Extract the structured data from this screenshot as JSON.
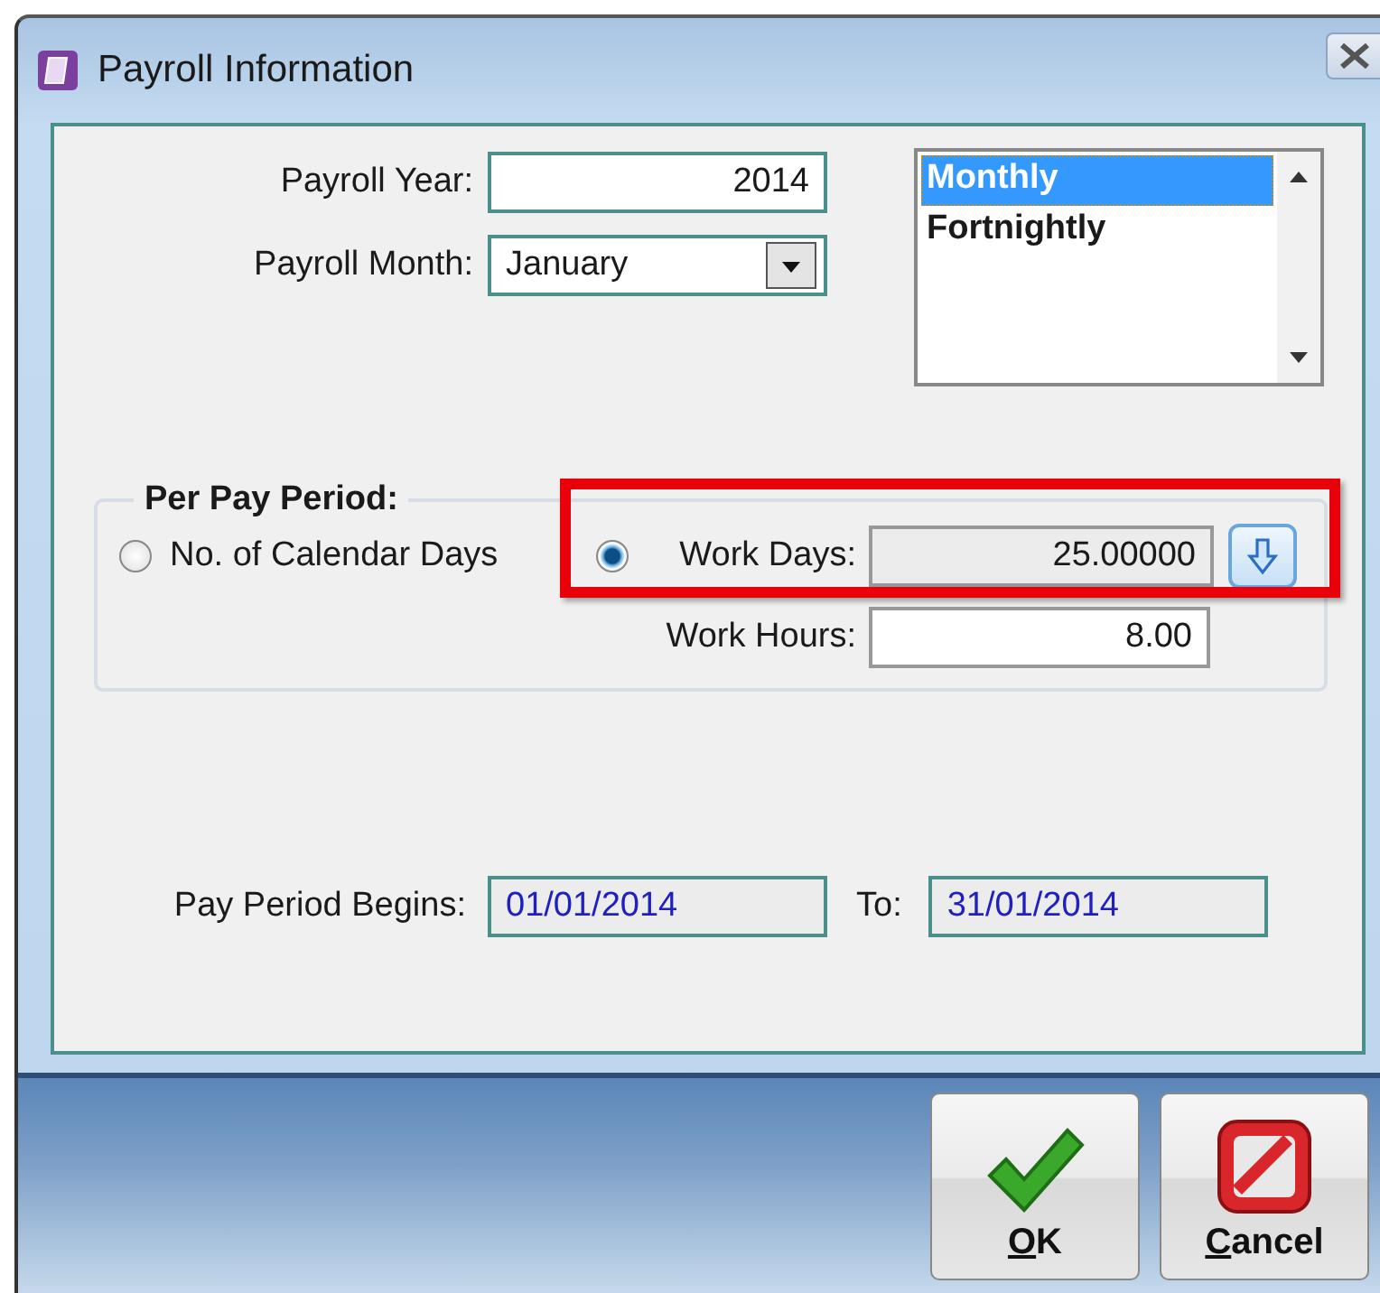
{
  "window": {
    "title": "Payroll Information"
  },
  "fields": {
    "payroll_year": {
      "label": "Payroll Year:",
      "value": "2014"
    },
    "payroll_month": {
      "label": "Payroll Month:",
      "value": "January"
    }
  },
  "frequency_list": {
    "items": [
      {
        "label": "Monthly",
        "selected": true
      },
      {
        "label": "Fortnightly",
        "selected": false
      }
    ]
  },
  "per_pay_period": {
    "title": "Per Pay Period:",
    "options": [
      {
        "label": "No. of Calendar Days",
        "selected": false,
        "highlighted": false
      },
      {
        "label": "Work Days:",
        "selected": true,
        "highlighted": true,
        "value": "25.00000"
      }
    ],
    "work_hours": {
      "label": "Work Hours:",
      "value": "8.00"
    }
  },
  "pay_period": {
    "begins_label": "Pay Period Begins:",
    "begins": "01/01/2014",
    "to_label": "To:",
    "to": "31/01/2014"
  },
  "buttons": [
    {
      "label": "OK",
      "kind": "ok"
    },
    {
      "label": "Cancel",
      "kind": "cancel"
    }
  ]
}
